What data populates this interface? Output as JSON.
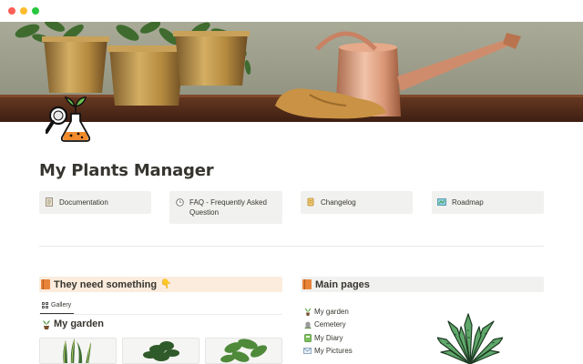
{
  "window": {
    "controls": [
      "close",
      "minimize",
      "maximize"
    ]
  },
  "cover": {
    "description_icon": "cover-image"
  },
  "page": {
    "title": "My Plants Manager",
    "icon": "plant-lab-icon"
  },
  "quick_links": [
    {
      "label": "Documentation",
      "icon": "document-icon"
    },
    {
      "label": "FAQ - Frequently Asked Question",
      "icon": "question-clock-icon"
    },
    {
      "label": "Changelog",
      "icon": "scroll-icon"
    },
    {
      "label": "Roadmap",
      "icon": "map-icon"
    }
  ],
  "left_section": {
    "heading": "They need something",
    "heading_icon": "book-icon",
    "heading_suffix_icon": "pointing-hand-icon",
    "view_tab": "Gallery",
    "gallery_title": "My garden",
    "gallery_cards": [
      "snake-plant",
      "potted-plant",
      "leafy-plant"
    ]
  },
  "right_section": {
    "heading": "Main pages",
    "heading_icon": "book-icon",
    "items": [
      {
        "label": "My garden",
        "icon": "plant-icon"
      },
      {
        "label": "Cemetery",
        "icon": "headstone-icon"
      },
      {
        "label": "My Diary",
        "icon": "diary-icon"
      },
      {
        "label": "My Pictures",
        "icon": "envelope-icon"
      }
    ]
  },
  "colors": {
    "text": "#37352f",
    "card_bg": "#f1f1ef",
    "callout_orange": "#fbecdd",
    "callout_gray": "#f1f1ef"
  }
}
